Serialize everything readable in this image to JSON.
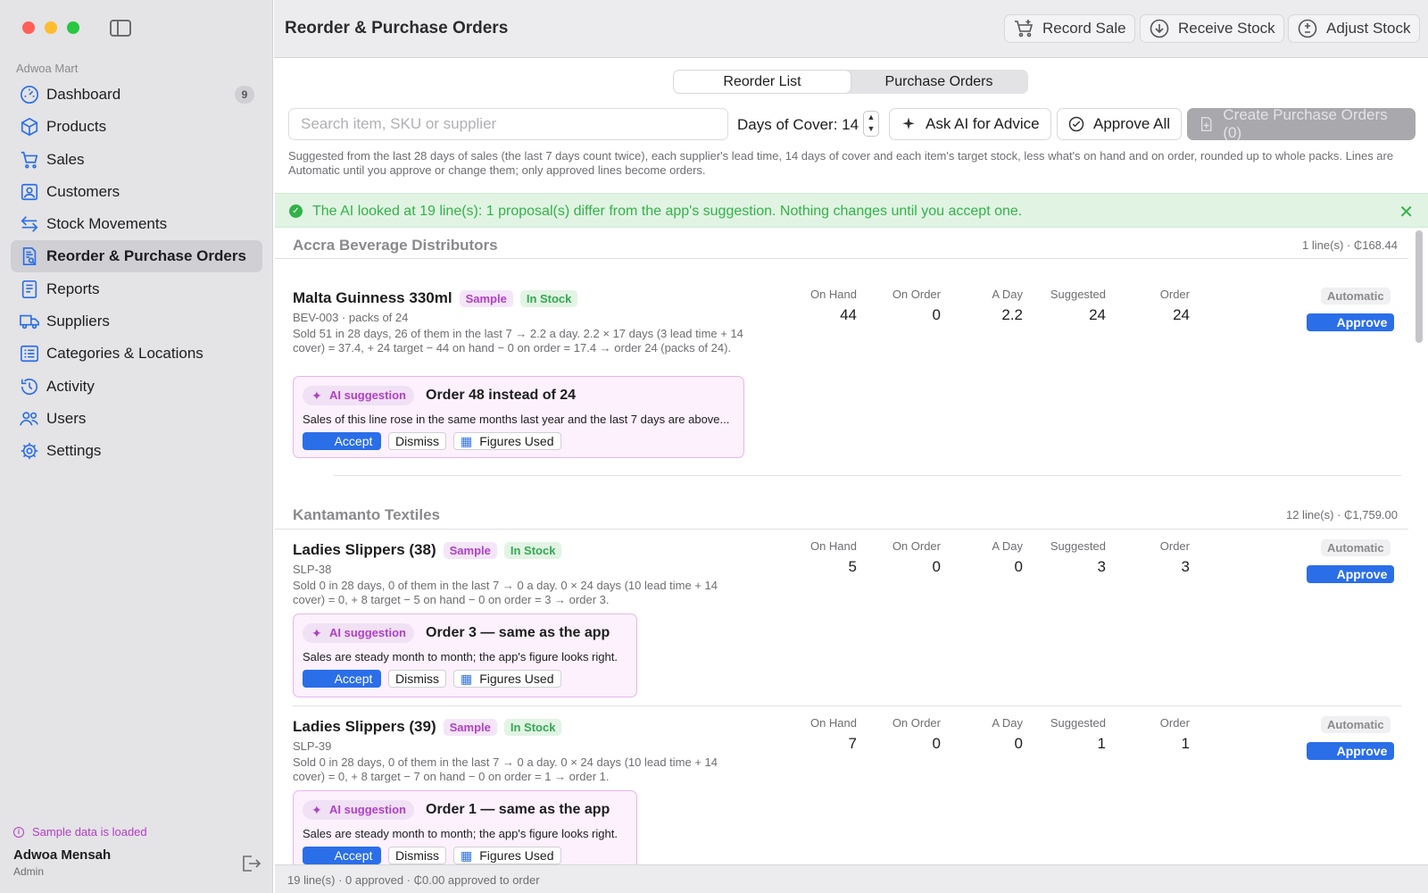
{
  "sidebar": {
    "store_name": "Adwoa Mart",
    "items": [
      {
        "label": "Dashboard",
        "icon": "dashboard-icon",
        "badge": "9"
      },
      {
        "label": "Products",
        "icon": "box-icon"
      },
      {
        "label": "Sales",
        "icon": "cart-icon"
      },
      {
        "label": "Customers",
        "icon": "person-icon"
      },
      {
        "label": "Stock Movements",
        "icon": "arrows-icon"
      },
      {
        "label": "Reorder & Purchase Orders",
        "icon": "document-search-icon"
      },
      {
        "label": "Reports",
        "icon": "report-icon"
      },
      {
        "label": "Suppliers",
        "icon": "truck-icon"
      },
      {
        "label": "Categories & Locations",
        "icon": "list-icon"
      },
      {
        "label": "Activity",
        "icon": "history-icon"
      },
      {
        "label": "Users",
        "icon": "users-icon"
      },
      {
        "label": "Settings",
        "icon": "gear-icon"
      }
    ],
    "sample_note": "Sample data is loaded",
    "user_name": "Adwoa Mensah",
    "user_role": "Admin"
  },
  "header": {
    "title": "Reorder & Purchase Orders",
    "record_sale": "Record Sale",
    "receive_stock": "Receive Stock",
    "adjust_stock": "Adjust Stock"
  },
  "tabs": [
    "Reorder List",
    "Purchase Orders"
  ],
  "toolbar": {
    "search_placeholder": "Search item, SKU or supplier",
    "days_label": "Days of Cover: 14",
    "ask_ai": "Ask AI for Advice",
    "approve_all": "Approve All",
    "create_po": "Create Purchase Orders (0)"
  },
  "explanation": "Suggested from the last 28 days of sales (the last 7 days count twice), each supplier's lead time, 14 days of cover and each item's target stock, less what's on hand and on order, rounded up to whole packs. Lines are Automatic until you approve or change them; only approved lines become orders.",
  "banner": "The AI looked at 19 line(s): 1 proposal(s) differ from the app's suggestion. Nothing changes until you accept one.",
  "columns": [
    "On Hand",
    "On Order",
    "A Day",
    "Suggested",
    "Order"
  ],
  "status_label": "Automatic",
  "approve_label": "Approve",
  "ai_pill": "AI suggestion",
  "accept_label": "Accept",
  "dismiss_label": "Dismiss",
  "figures_label": "Figures Used",
  "groups": [
    {
      "name": "Accra Beverage Distributors",
      "summary": "1 line(s) · ₵168.44",
      "items": [
        {
          "name": "Malta Guinness 330ml",
          "tag1": "Sample",
          "tag2": "In Stock",
          "sku": "BEV-003 · packs of 24",
          "calc": "Sold 51 in 28 days, 26 of them in the last 7 → 2.2 a day. 2.2 × 17 days (3 lead time + 14 cover) = 37.4, + 24 target − 44 on hand − 0 on order = 17.4 → order 24 (packs of 24).",
          "on_hand": "44",
          "on_order": "0",
          "a_day": "2.2",
          "suggested": "24",
          "order": "24",
          "ai_headline": "Order 48 instead of 24",
          "ai_reason": "Sales of this line rose in the same months last year and the last 7 days are above..."
        }
      ]
    },
    {
      "name": "Kantamanto Textiles",
      "summary": "12 line(s) · ₵1,759.00",
      "items": [
        {
          "name": "Ladies Slippers (38)",
          "tag1": "Sample",
          "tag2": "In Stock",
          "sku": "SLP-38",
          "calc": "Sold 0 in 28 days, 0 of them in the last 7 → 0 a day. 0 × 24 days (10 lead time + 14 cover) = 0, + 8 target − 5 on hand − 0 on order = 3 → order 3.",
          "on_hand": "5",
          "on_order": "0",
          "a_day": "0",
          "suggested": "3",
          "order": "3",
          "ai_headline": "Order 3 — same as the app",
          "ai_reason": "Sales are steady month to month; the app's figure looks right."
        },
        {
          "name": "Ladies Slippers (39)",
          "tag1": "Sample",
          "tag2": "In Stock",
          "sku": "SLP-39",
          "calc": "Sold 0 in 28 days, 0 of them in the last 7 → 0 a day. 0 × 24 days (10 lead time + 14 cover) = 0, + 8 target − 7 on hand − 0 on order = 1 → order 1.",
          "on_hand": "7",
          "on_order": "0",
          "a_day": "0",
          "suggested": "1",
          "order": "1",
          "ai_headline": "Order 1 — same as the app",
          "ai_reason": "Sales are steady month to month; the app's figure looks right."
        }
      ]
    }
  ],
  "footer": "19 line(s) · 0 approved · ₵0.00 approved to order",
  "colors": {
    "accent": "#2a6ee8",
    "ai": "#b03fc8",
    "success": "#33b249"
  }
}
